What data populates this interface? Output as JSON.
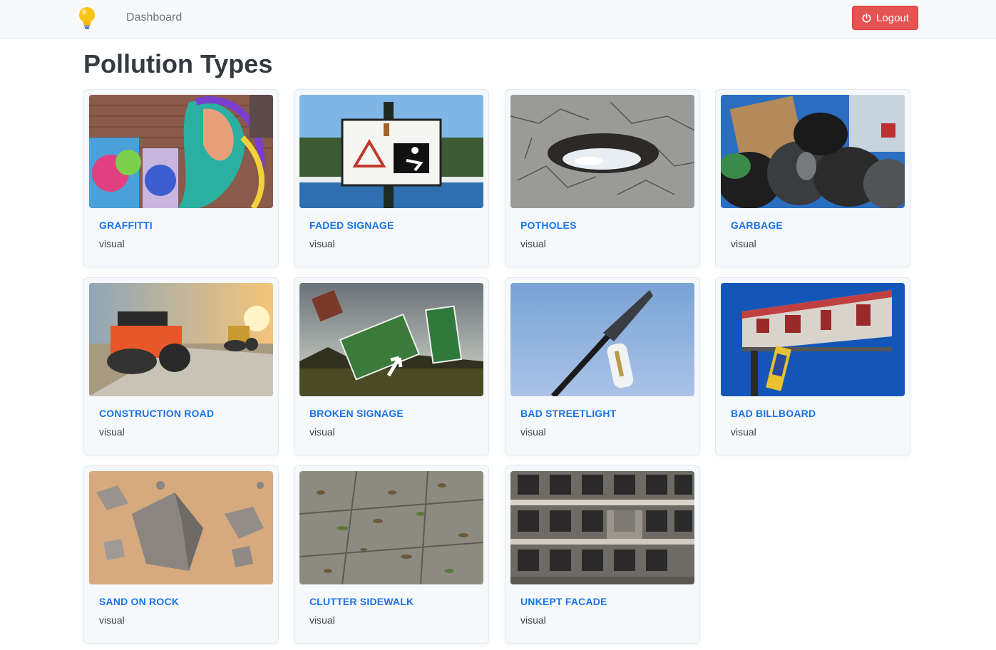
{
  "navbar": {
    "logo": "lightbulb-icon",
    "dashboard_label": "Dashboard",
    "logout_label": "Logout",
    "logout_icon": "power-icon",
    "logout_color": "#e55353"
  },
  "page": {
    "title": "Pollution Types"
  },
  "cards": [
    {
      "title": "GRAFFITTI",
      "category": "visual",
      "image": "graffiti-mural"
    },
    {
      "title": "FADED SIGNAGE",
      "category": "visual",
      "image": "cliff-risk-sign"
    },
    {
      "title": "POTHOLES",
      "category": "visual",
      "image": "pothole-road"
    },
    {
      "title": "GARBAGE",
      "category": "visual",
      "image": "garbage-bags"
    },
    {
      "title": "CONSTRUCTION ROAD",
      "category": "visual",
      "image": "road-rollers"
    },
    {
      "title": "BROKEN SIGNAGE",
      "category": "visual",
      "image": "tilted-exit-sign"
    },
    {
      "title": "BAD STREETLIGHT",
      "category": "visual",
      "image": "streetlight"
    },
    {
      "title": "BAD BILLBOARD",
      "category": "visual",
      "image": "torn-billboard"
    },
    {
      "title": "SAND ON ROCK",
      "category": "visual",
      "image": "sand-rocks"
    },
    {
      "title": "CLUTTER SIDEWALK",
      "category": "visual",
      "image": "leafy-sidewalk"
    },
    {
      "title": "UNKEPT FACADE",
      "category": "visual",
      "image": "old-building-facade"
    }
  ]
}
